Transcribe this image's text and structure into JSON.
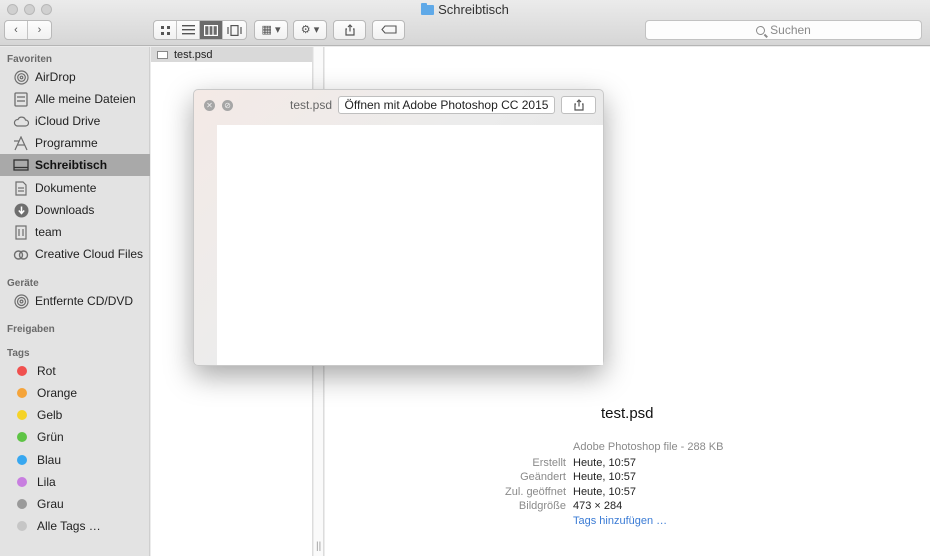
{
  "window": {
    "title": "Schreibtisch",
    "search_placeholder": "Suchen"
  },
  "sidebar": {
    "sections": {
      "favorites": "Favoriten",
      "devices": "Geräte",
      "shared": "Freigaben",
      "tags": "Tags"
    },
    "favorites": [
      {
        "label": "AirDrop",
        "icon": "airdrop-icon"
      },
      {
        "label": "Alle meine Dateien",
        "icon": "all-files-icon"
      },
      {
        "label": "iCloud Drive",
        "icon": "cloud-icon"
      },
      {
        "label": "Programme",
        "icon": "applications-icon"
      },
      {
        "label": "Schreibtisch",
        "icon": "desktop-icon",
        "selected": true
      },
      {
        "label": "Dokumente",
        "icon": "documents-icon"
      },
      {
        "label": "Downloads",
        "icon": "downloads-icon"
      },
      {
        "label": "team",
        "icon": "building-icon"
      },
      {
        "label": "Creative Cloud Files",
        "icon": "creative-cloud-icon"
      }
    ],
    "devices": [
      {
        "label": "Entfernte CD/DVD",
        "icon": "disc-icon"
      }
    ],
    "tags": [
      {
        "label": "Rot",
        "color": "#f0504e"
      },
      {
        "label": "Orange",
        "color": "#f5a43a"
      },
      {
        "label": "Gelb",
        "color": "#f5d327"
      },
      {
        "label": "Grün",
        "color": "#5ec445"
      },
      {
        "label": "Blau",
        "color": "#37a7f0"
      },
      {
        "label": "Lila",
        "color": "#c87ee0"
      },
      {
        "label": "Grau",
        "color": "#9a9a9a"
      },
      {
        "label": "Alle Tags …",
        "color": "#c6c6c6"
      }
    ]
  },
  "column": {
    "file": "test.psd"
  },
  "quicklook": {
    "title": "test.psd",
    "open_with": "Öffnen mit Adobe Photoshop CC 2015"
  },
  "preview": {
    "name": "test.psd",
    "kind": "Adobe Photoshop file - 288 KB",
    "meta": [
      {
        "label": "Erstellt",
        "value": "Heute, 10:57"
      },
      {
        "label": "Geändert",
        "value": "Heute, 10:57"
      },
      {
        "label": "Zul. geöffnet",
        "value": "Heute, 10:57"
      },
      {
        "label": "Bildgröße",
        "value": "473 × 284"
      }
    ],
    "add_tags": "Tags hinzufügen …"
  }
}
